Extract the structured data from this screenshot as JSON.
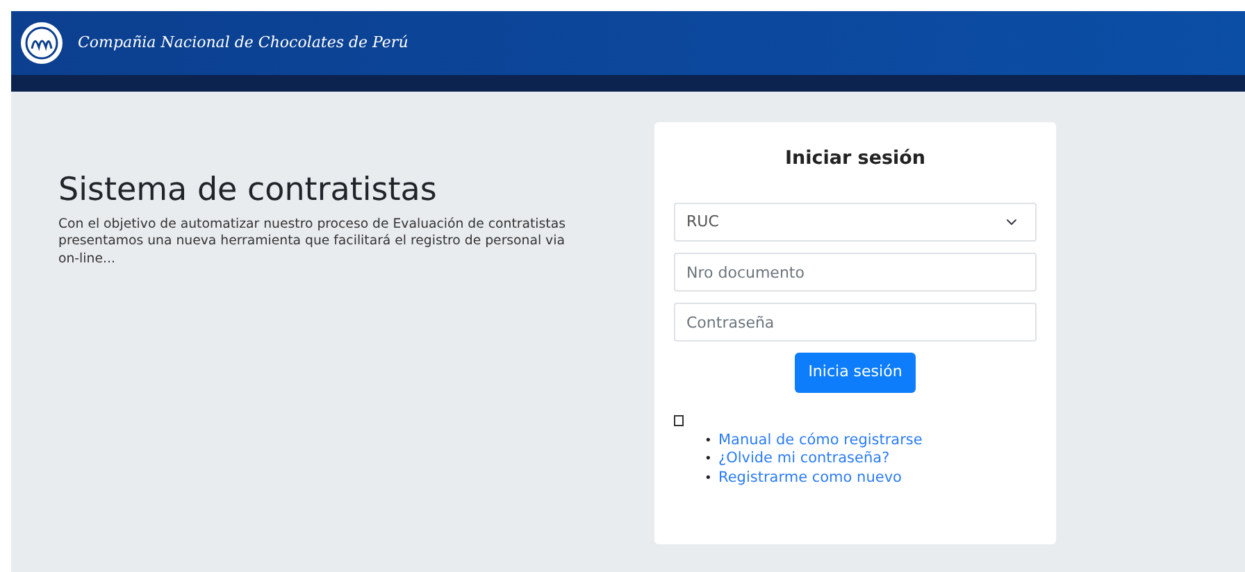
{
  "header": {
    "company_name": "Compañia Nacional de Chocolates de Perú"
  },
  "intro": {
    "title": "Sistema de contratistas",
    "description": "Con el objetivo de automatizar nuestro proceso de Evaluación de contratistas presentamos una nueva herramienta que facilitará el registro de personal via on-line..."
  },
  "login": {
    "title": "Iniciar sesión",
    "document_type": "RUC",
    "document_number": {
      "placeholder": "Nro documento"
    },
    "password": {
      "placeholder": "Contraseña"
    },
    "submit": "Inicia sesión",
    "links": [
      {
        "bullet": "•",
        "label": "Manual de cómo registrarse"
      },
      {
        "bullet": "•",
        "label": "¿Olvide mi contraseña?"
      },
      {
        "bullet": "•",
        "label": "Registrarme como nuevo"
      }
    ]
  }
}
